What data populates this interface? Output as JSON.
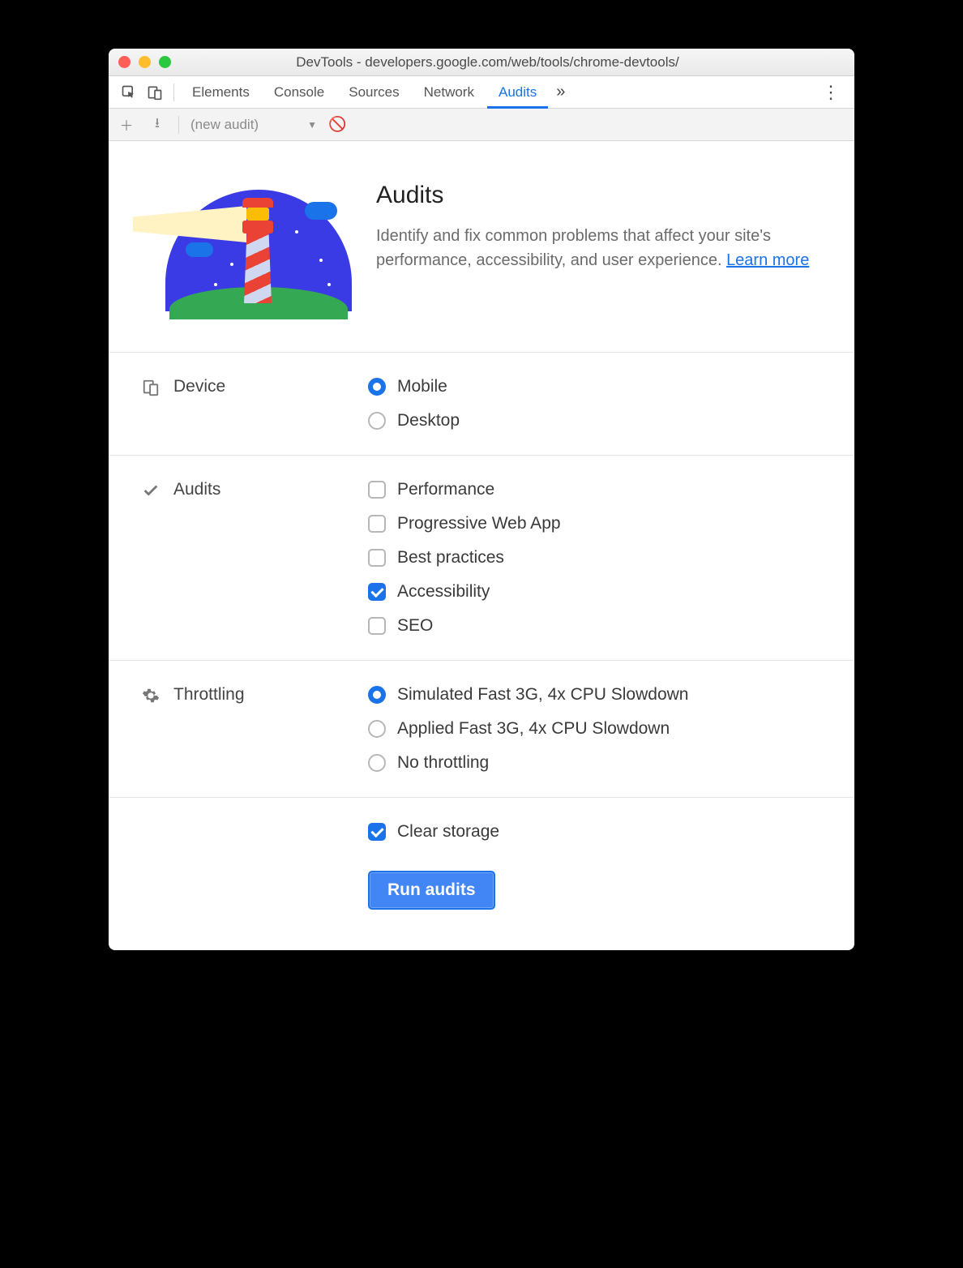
{
  "window": {
    "title": "DevTools - developers.google.com/web/tools/chrome-devtools/"
  },
  "tabs": {
    "items": [
      "Elements",
      "Console",
      "Sources",
      "Network",
      "Audits"
    ],
    "active": "Audits"
  },
  "subbar": {
    "dropdown": "(new audit)"
  },
  "hero": {
    "title": "Audits",
    "description": "Identify and fix common problems that affect your site's performance, accessibility, and user experience. ",
    "learn_more": "Learn more"
  },
  "sections": {
    "device": {
      "label": "Device",
      "options": [
        {
          "label": "Mobile",
          "checked": true
        },
        {
          "label": "Desktop",
          "checked": false
        }
      ]
    },
    "audits": {
      "label": "Audits",
      "options": [
        {
          "label": "Performance",
          "checked": false
        },
        {
          "label": "Progressive Web App",
          "checked": false
        },
        {
          "label": "Best practices",
          "checked": false
        },
        {
          "label": "Accessibility",
          "checked": true
        },
        {
          "label": "SEO",
          "checked": false
        }
      ]
    },
    "throttling": {
      "label": "Throttling",
      "options": [
        {
          "label": "Simulated Fast 3G, 4x CPU Slowdown",
          "checked": true
        },
        {
          "label": "Applied Fast 3G, 4x CPU Slowdown",
          "checked": false
        },
        {
          "label": "No throttling",
          "checked": false
        }
      ]
    },
    "clear_storage": {
      "label": "Clear storage",
      "checked": true
    }
  },
  "actions": {
    "run": "Run audits"
  }
}
